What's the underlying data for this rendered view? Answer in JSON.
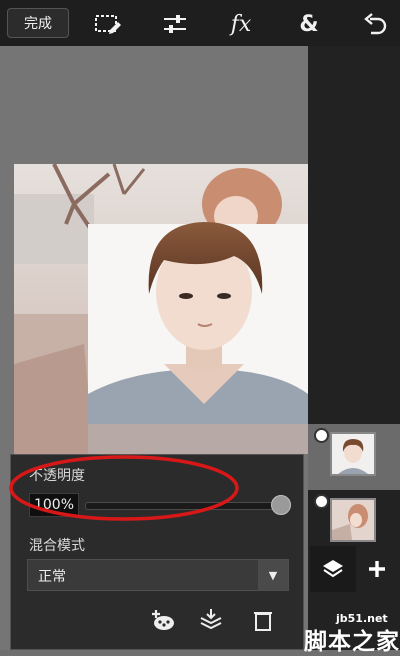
{
  "toolbar": {
    "done_label": "完成",
    "fx_label": "fx",
    "ampersand_label": "&",
    "icons": [
      "select-edit-icon",
      "adjust-sliders-icon",
      "effects-icon",
      "blend-ampersand-icon",
      "undo-icon"
    ]
  },
  "layer_panel": {
    "opacity_label": "不透明度",
    "opacity_value": "100%",
    "opacity_level": 1.0,
    "blend_mode_label": "混合模式",
    "blend_mode_value": "正常",
    "bottom_icons": [
      "add-layer-from-photo-icon",
      "merge-layers-icon",
      "delete-layer-icon"
    ]
  },
  "layers_sidebar": {
    "layers": [
      {
        "name": "portrait-layer",
        "selected": true
      },
      {
        "name": "background-photo-layer",
        "selected": false
      }
    ],
    "buttons": [
      "layers-icon",
      "add-icon"
    ]
  },
  "watermark": {
    "site": "jb51.net",
    "text": "脚本之家"
  },
  "colors": {
    "toolbar": "#1e1e1e",
    "panel": "#2b2b2b",
    "annotation": "#d81818"
  }
}
